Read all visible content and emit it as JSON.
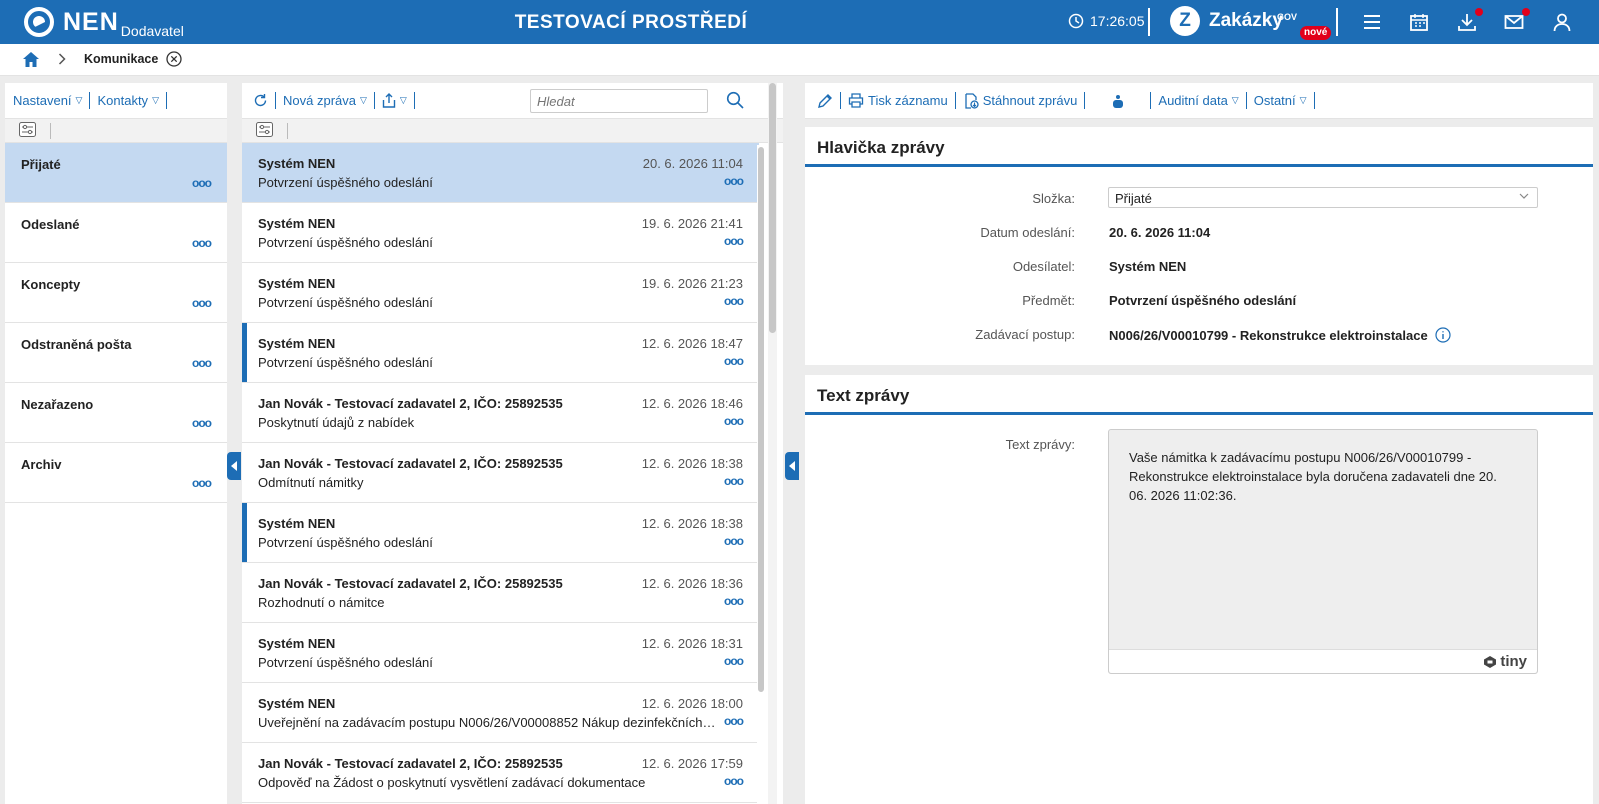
{
  "header": {
    "brand": "NEN",
    "role": "Dodavatel",
    "env_title": "TESTOVACÍ PROSTŘEDÍ",
    "clock": "17:26:05",
    "zakazky": "Zakázky",
    "gov": "GOV",
    "nove": "nové",
    "accent": "#1d6db5",
    "icons": [
      "menu-icon",
      "calendar-icon",
      "download-icon",
      "mail-icon",
      "user-icon"
    ]
  },
  "breadcrumb": {
    "current": "Komunikace"
  },
  "folders_toolbar": {
    "settings": "Nastavení",
    "contacts": "Kontakty"
  },
  "folders": [
    {
      "label": "Přijaté",
      "active": true
    },
    {
      "label": "Odeslané"
    },
    {
      "label": "Koncepty"
    },
    {
      "label": "Odstraněná pošta"
    },
    {
      "label": "Nezařazeno"
    },
    {
      "label": "Archiv"
    }
  ],
  "list_toolbar": {
    "new_message": "Nová zpráva",
    "search_placeholder": "Hledat"
  },
  "messages": [
    {
      "from": "Systém NEN",
      "date": "20. 6. 2026 11:04",
      "subject": "Potvrzení úspěšného odeslání",
      "active": true
    },
    {
      "from": "Systém NEN",
      "date": "19. 6. 2026 21:41",
      "subject": "Potvrzení úspěšného odeslání"
    },
    {
      "from": "Systém NEN",
      "date": "19. 6. 2026 21:23",
      "subject": "Potvrzení úspěšného odeslání"
    },
    {
      "from": "Systém NEN",
      "date": "12. 6. 2026 18:47",
      "subject": "Potvrzení úspěšného odeslání",
      "marked": true
    },
    {
      "from": "Jan Novák - Testovací zadavatel 2, IČO: 25892535",
      "date": "12. 6. 2026 18:46",
      "subject": "Poskytnutí údajů z nabídek"
    },
    {
      "from": "Jan Novák - Testovací zadavatel 2, IČO: 25892535",
      "date": "12. 6. 2026 18:38",
      "subject": "Odmítnutí námitky"
    },
    {
      "from": "Systém NEN",
      "date": "12. 6. 2026 18:38",
      "subject": "Potvrzení úspěšného odeslání",
      "marked": true
    },
    {
      "from": "Jan Novák - Testovací zadavatel 2, IČO: 25892535",
      "date": "12. 6. 2026 18:36",
      "subject": "Rozhodnutí o námitce"
    },
    {
      "from": "Systém NEN",
      "date": "12. 6. 2026 18:31",
      "subject": "Potvrzení úspěšného odeslání"
    },
    {
      "from": "Systém NEN",
      "date": "12. 6. 2026 18:00",
      "subject": "Uveřejnění na zadávacím postupu N006/26/V00008852 Nákup dezinfekčních p..."
    },
    {
      "from": "Jan Novák - Testovací zadavatel 2, IČO: 25892535",
      "date": "12. 6. 2026 17:59",
      "subject": "Odpověď na Žádost o poskytnutí vysvětlení zadávací dokumentace"
    }
  ],
  "detail_toolbar": {
    "print": "Tisk záznamu",
    "download": "Stáhnout zprávu",
    "audit": "Auditní data",
    "other": "Ostatní"
  },
  "header_section": {
    "title": "Hlavička zprávy",
    "folder_label": "Složka:",
    "folder_value": "Přijaté",
    "sent_label": "Datum odeslání:",
    "sent_value": "20. 6. 2026 11:04",
    "sender_label": "Odesílatel:",
    "sender_value": "Systém NEN",
    "subject_label": "Předmět:",
    "subject_value": "Potvrzení úspěšného odeslání",
    "procedure_label": "Zadávací postup:",
    "procedure_value": "N006/26/V00010799 - Rekonstrukce elektroinstalace"
  },
  "text_section": {
    "title": "Text zprávy",
    "label": "Text zprávy:",
    "body": "Vaše námitka k zadávacímu postupu N006/26/V00010799 - Rekonstrukce elektroinstalace byla doručena zadavateli dne 20. 06. 2026 11:02:36.",
    "editor_brand": "tiny"
  }
}
